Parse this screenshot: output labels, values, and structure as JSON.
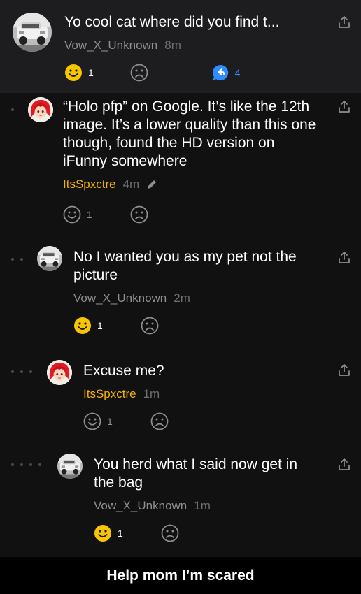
{
  "comments": [
    {
      "text": "Yo cool cat where did you find t...",
      "username": "Vow_X_Unknown",
      "time": "8m",
      "avatar": "car-avatar",
      "smile_count": "1",
      "reply_count": "4"
    },
    {
      "text": "“Holo pfp” on Google. It’s like the 12th image. It’s a lower quality than this one though, found the HD version on iFunny somewhere",
      "username": "ItsSpxctre",
      "time": "4m",
      "avatar": "anime-avatar",
      "smile_count": "1",
      "edited": true
    },
    {
      "text": "No I wanted you as my pet not the picture",
      "username": "Vow_X_Unknown",
      "time": "2m",
      "avatar": "car-avatar",
      "smile_count": "1"
    },
    {
      "text": "Excuse me?",
      "username": "ItsSpxctre",
      "time": "1m",
      "avatar": "anime-avatar",
      "smile_count": "1"
    },
    {
      "text": "You herd what I said now get in the bag",
      "username": "Vow_X_Unknown",
      "time": "1m",
      "avatar": "car-avatar",
      "smile_count": "1"
    }
  ],
  "caption": "Help mom I’m scared",
  "colors": {
    "gold": "#f5b400",
    "gray_text": "#8e8e93",
    "blue": "#2f8cff",
    "top_comment_bg": "#1d1d1f",
    "reply_bg": "#111111"
  },
  "icons": [
    "smile-icon",
    "frown-icon",
    "reply-icon",
    "share-icon",
    "pencil-icon"
  ]
}
